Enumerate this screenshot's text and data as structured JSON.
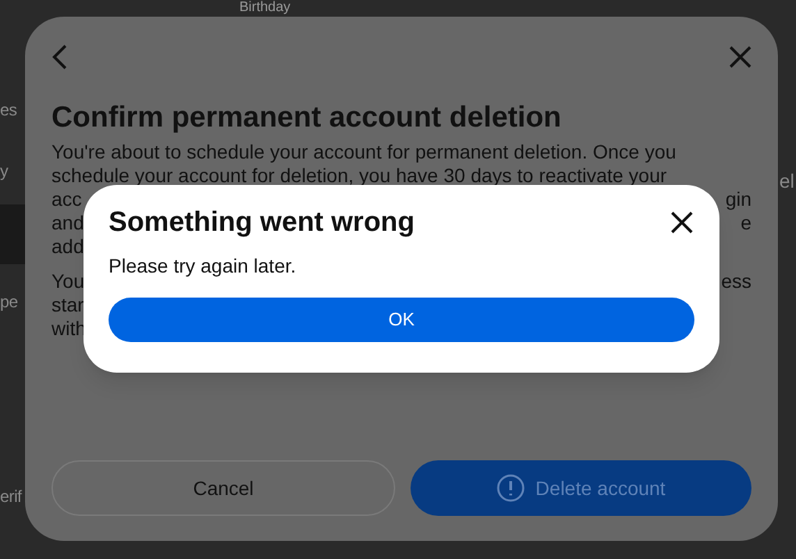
{
  "background_page": {
    "heading": "Birthday",
    "left_fragments": [
      "es",
      "y",
      "pe",
      "erif"
    ],
    "right_fragment": "el"
  },
  "dialog": {
    "title": "Confirm permanent account deletion",
    "paragraphs": [
      {
        "lines": [
          {
            "left": "You're about to schedule your account for permanent deletion. Once you"
          },
          {
            "left": "schedule your account for deletion, you have 30 days to reactivate your"
          },
          {
            "left": "acc",
            "right": "gin"
          },
          {
            "left": "and",
            "right": "e"
          },
          {
            "left": "add"
          }
        ]
      },
      {
        "lines": [
          {
            "left": "You",
            "right": "ess"
          },
          {
            "left": "star"
          },
          {
            "left": "with"
          }
        ]
      }
    ],
    "buttons": [
      {
        "label": "Cancel",
        "kind": "secondary",
        "disabled": false
      },
      {
        "label": "Delete account",
        "kind": "primary",
        "disabled": true
      }
    ]
  },
  "alert": {
    "title": "Something went wrong",
    "message": "Please try again later.",
    "button": "OK"
  }
}
